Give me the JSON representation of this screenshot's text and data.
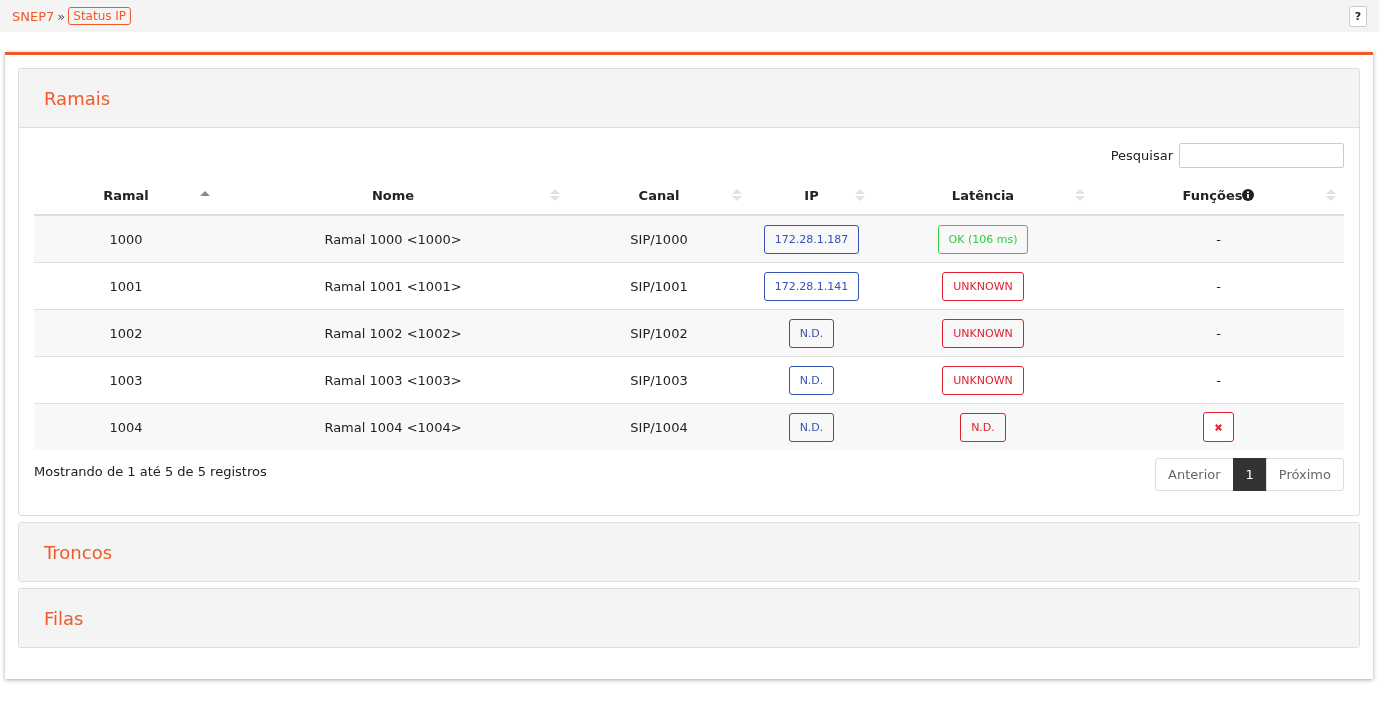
{
  "breadcrumb": {
    "root": "SNEP7",
    "separator": "»",
    "current": "Status IP"
  },
  "help_button": "?",
  "panels": [
    {
      "title": "Ramais",
      "expanded": true,
      "search": {
        "label": "Pesquisar"
      },
      "table": {
        "columns": [
          {
            "label": "Ramal",
            "sorted": true
          },
          {
            "label": "Nome",
            "sorted": false
          },
          {
            "label": "Canal",
            "sorted": false
          },
          {
            "label": "IP",
            "sorted": false
          },
          {
            "label": "Latência",
            "sorted": false
          },
          {
            "label": "Funções",
            "sorted": false,
            "info": true
          }
        ],
        "rows": [
          {
            "ramal": "1000",
            "nome": "Ramal 1000 <1000>",
            "canal": "SIP/1000",
            "ip": "172.28.1.187",
            "latency": {
              "text": "OK (106 ms)",
              "kind": "ok"
            },
            "function": {
              "kind": "text",
              "text": "-"
            }
          },
          {
            "ramal": "1001",
            "nome": "Ramal 1001 <1001>",
            "canal": "SIP/1001",
            "ip": "172.28.1.141",
            "latency": {
              "text": "UNKNOWN",
              "kind": "error"
            },
            "function": {
              "kind": "text",
              "text": "-"
            }
          },
          {
            "ramal": "1002",
            "nome": "Ramal 1002 <1002>",
            "canal": "SIP/1002",
            "ip": "N.D.",
            "latency": {
              "text": "UNKNOWN",
              "kind": "error"
            },
            "function": {
              "kind": "text",
              "text": "-"
            }
          },
          {
            "ramal": "1003",
            "nome": "Ramal 1003 <1003>",
            "canal": "SIP/1003",
            "ip": "N.D.",
            "latency": {
              "text": "UNKNOWN",
              "kind": "error"
            },
            "function": {
              "kind": "text",
              "text": "-"
            }
          },
          {
            "ramal": "1004",
            "nome": "Ramal 1004 <1004>",
            "canal": "SIP/1004",
            "ip": "N.D.",
            "latency": {
              "text": "N.D.",
              "kind": "error"
            },
            "function": {
              "kind": "remove"
            }
          }
        ]
      },
      "info": "Mostrando de 1 até 5 de 5 registros",
      "pagination": [
        {
          "label": "Anterior",
          "selected": false
        },
        {
          "label": "1",
          "selected": true
        },
        {
          "label": "Próximo",
          "selected": false
        }
      ]
    },
    {
      "title": "Troncos",
      "expanded": false
    },
    {
      "title": "Filas",
      "expanded": false
    }
  ]
}
